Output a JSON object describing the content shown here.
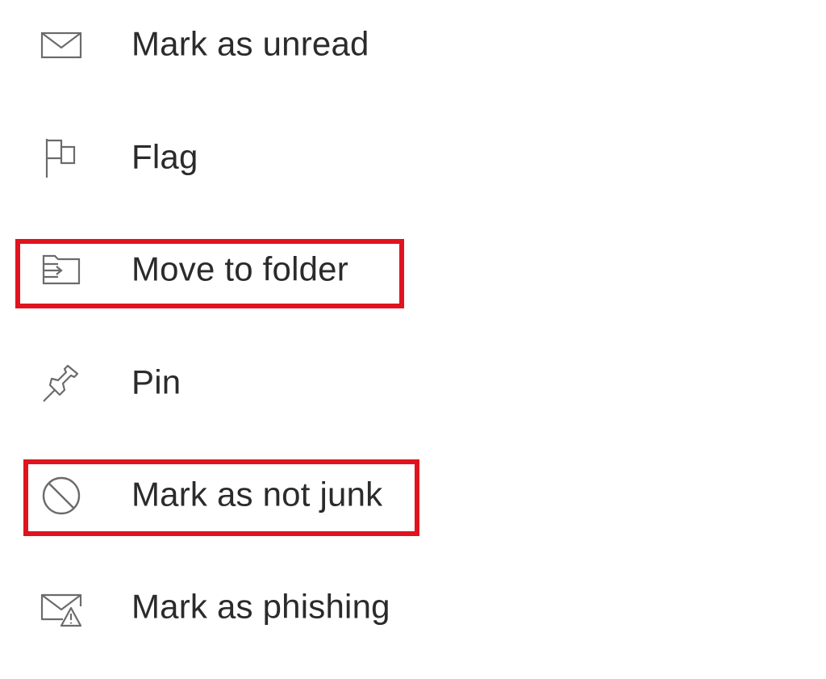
{
  "menu": {
    "items": [
      {
        "label": "Mark as unread",
        "icon": "envelope-icon"
      },
      {
        "label": "Flag",
        "icon": "flag-icon"
      },
      {
        "label": "Move to folder",
        "icon": "move-to-folder-icon"
      },
      {
        "label": "Pin",
        "icon": "pin-icon"
      },
      {
        "label": "Mark as not junk",
        "icon": "block-icon"
      },
      {
        "label": "Mark as phishing",
        "icon": "phishing-envelope-icon"
      }
    ],
    "highlighted": [
      "Move to folder",
      "Mark as not junk"
    ]
  },
  "colors": {
    "text": "#2b2b2b",
    "icon": "#6b6b6b",
    "highlight": "#e0141e",
    "background": "#ffffff"
  }
}
